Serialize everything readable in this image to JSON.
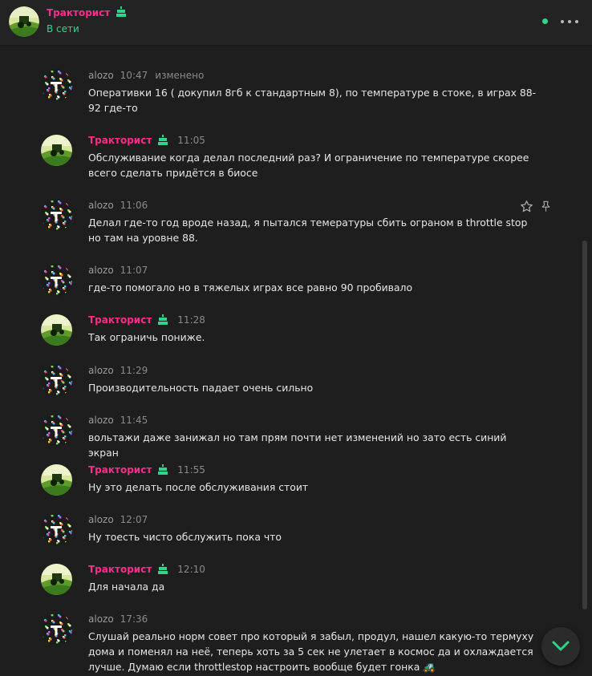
{
  "header": {
    "name": "Тракторист",
    "status": "В сети"
  },
  "messages": [
    {
      "author": "alozo",
      "time": "10:47",
      "edited": "изменено",
      "text": "Оперативки 16 ( докупил 8гб к стандартным 8), по температуре в стоке, в играх 88-92 где-то"
    },
    {
      "author": "Тракторист",
      "time": "11:05",
      "text": "Обслуживание когда делал последний раз? И ограничение по температуре скорее всего сделать придётся в биосе"
    },
    {
      "author": "alozo",
      "time": "11:06",
      "text": "Делал где-то год вроде назад, я пытался темературы сбить огpаном в throttle stop но там на уровне 88."
    },
    {
      "author": "alozo",
      "time": "11:07",
      "text": "где-то помогало но в тяжелых играх все равно 90 пробивало"
    },
    {
      "author": "Тракторист",
      "time": "11:28",
      "text": "Так ограничь пониже."
    },
    {
      "author": "alozo",
      "time": "11:29",
      "text": "Производительность падает очень сильно"
    },
    {
      "author": "alozo",
      "time": "11:45",
      "text": "вольтажи даже занижал но там прям почти нет изменений но зато есть синий экран"
    },
    {
      "author": "Тракторист",
      "time": "11:55",
      "text": "Ну это делать после обслуживания стоит"
    },
    {
      "author": "alozo",
      "time": "12:07",
      "text": "Ну тоесть чисто обслужить пока что"
    },
    {
      "author": "Тракторист",
      "time": "12:10",
      "text": "Для начала да"
    },
    {
      "author": "alozo",
      "time": "17:36",
      "text": "Слушай реально норм совет про который я забыл, продул, нашел какую-то термуху дома и поменял на неё, теперь хоть за 5 сек не улетает в космос да и охлаждается лучше. Думаю если throttlestop настроить вообще будет гонка 🚜"
    }
  ],
  "colors": {
    "accent_name": "#ff2b88",
    "online": "#2fd58b",
    "background": "#1e1e1f"
  },
  "icons": {
    "more": "more-dots-icon",
    "star": "star-icon",
    "pin": "pin-icon",
    "scroll_down": "chevron-down-icon",
    "birthday": "cake-icon"
  }
}
